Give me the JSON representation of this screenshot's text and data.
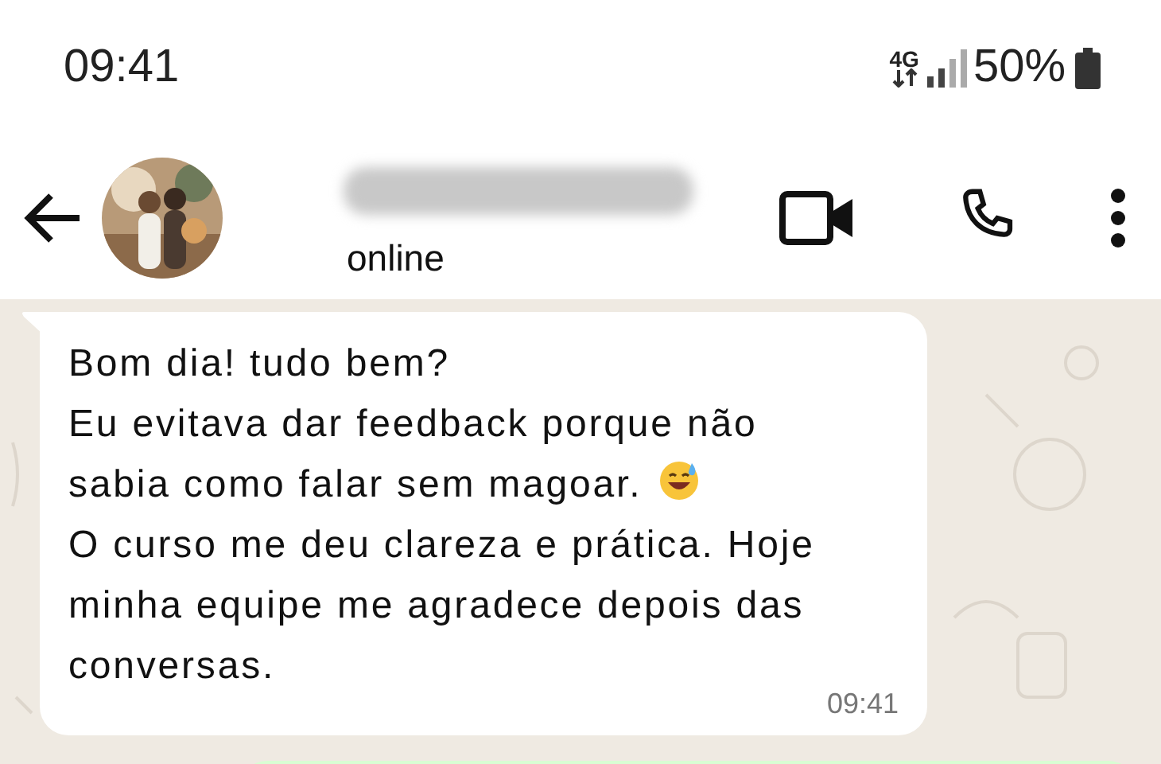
{
  "status_bar": {
    "time": "09:41",
    "network": "4G",
    "battery": "50%"
  },
  "header": {
    "status": "online"
  },
  "messages": [
    {
      "kind": "incoming",
      "lines": [
        {
          "text": "Bom dia! tudo bem?",
          "emoji": false
        },
        {
          "text": "Eu evitava dar feedback porque não",
          "emoji": false
        },
        {
          "text": "sabia como falar sem magoar.",
          "emoji": true
        },
        {
          "text": "O curso me deu clareza e prática. Hoje",
          "emoji": false
        },
        {
          "text": "minha equipe me agradece depois das",
          "emoji": false
        },
        {
          "text": "conversas.",
          "emoji": false
        }
      ],
      "time": "09:41"
    },
    {
      "kind": "outgoing"
    }
  ]
}
